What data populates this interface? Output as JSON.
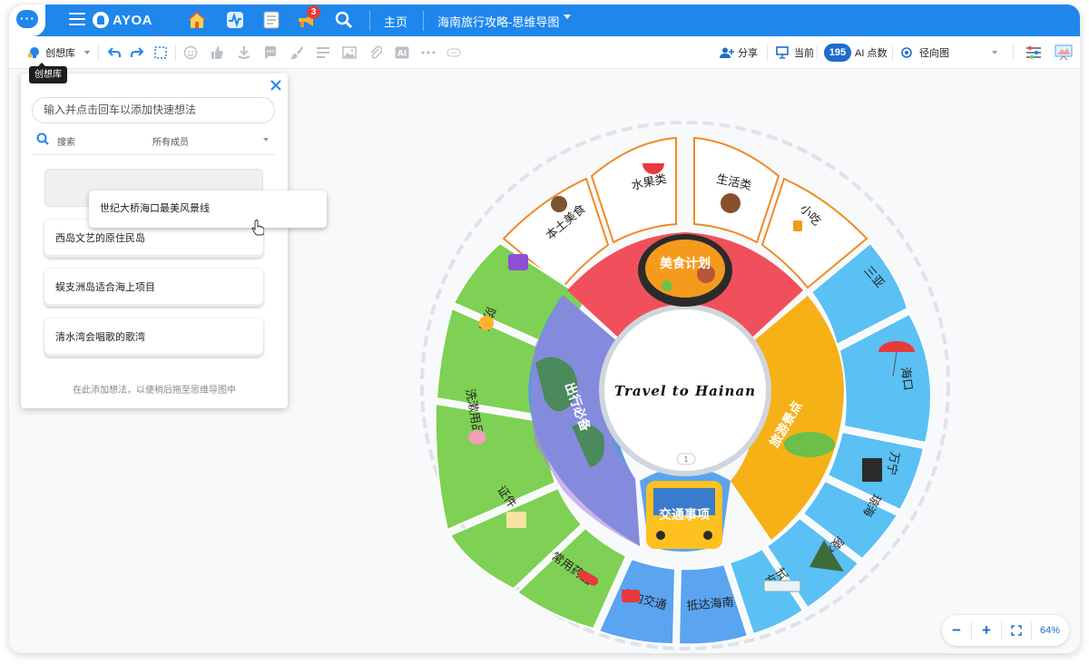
{
  "app": {
    "brand": "AYOA",
    "notification_count": "3"
  },
  "breadcrumb": {
    "home": "主页",
    "title": "海南旅行攻略-思维导图"
  },
  "toolbar": {
    "ideas_label": "创想库",
    "share_label": "分享",
    "present_label": "当前",
    "ai_points": "195",
    "ai_label": "AI 点数",
    "view_mode": "径向图"
  },
  "tooltip": {
    "text": "创想库"
  },
  "ideas_panel": {
    "quick_input_placeholder": "输入并点击回车以添加快速想法",
    "search_label": "搜索",
    "member_filter": "所有成员",
    "dragging_card": "世纪大桥海口最美风景线",
    "cards": [
      "西岛文艺的原住民岛",
      "蜈支洲岛适合海上项目",
      "清水湾会唱歌的歌湾"
    ],
    "hint": "在此添加想法，以便稍后拖至思维导图中"
  },
  "mindmap": {
    "center": "Travel to Hainan",
    "comment_count": "1",
    "core_branches": [
      "美食计划",
      "旅游景点",
      "交通事项",
      "出行必备"
    ],
    "food_items": [
      "本土美食",
      "水果类",
      "生活类",
      "小吃"
    ],
    "spot_items": [
      "三亚",
      "海口",
      "万宁",
      "琼海",
      "陵水"
    ],
    "transport_items": [
      "方式",
      "抵达海南",
      "市内交通"
    ],
    "essentials_items": [
      "常用药品",
      "证件",
      "洗漱用品",
      "防晒",
      ""
    ]
  },
  "zoom": {
    "level": "64%"
  },
  "colors": {
    "brand_blue": "#1f86ec",
    "food_red": "#f0505c",
    "spots_orange": "#f6b117",
    "transport_blue": "#5aa4f0",
    "essentials_green": "#7ed154",
    "sky_blue": "#5bc0f4"
  }
}
